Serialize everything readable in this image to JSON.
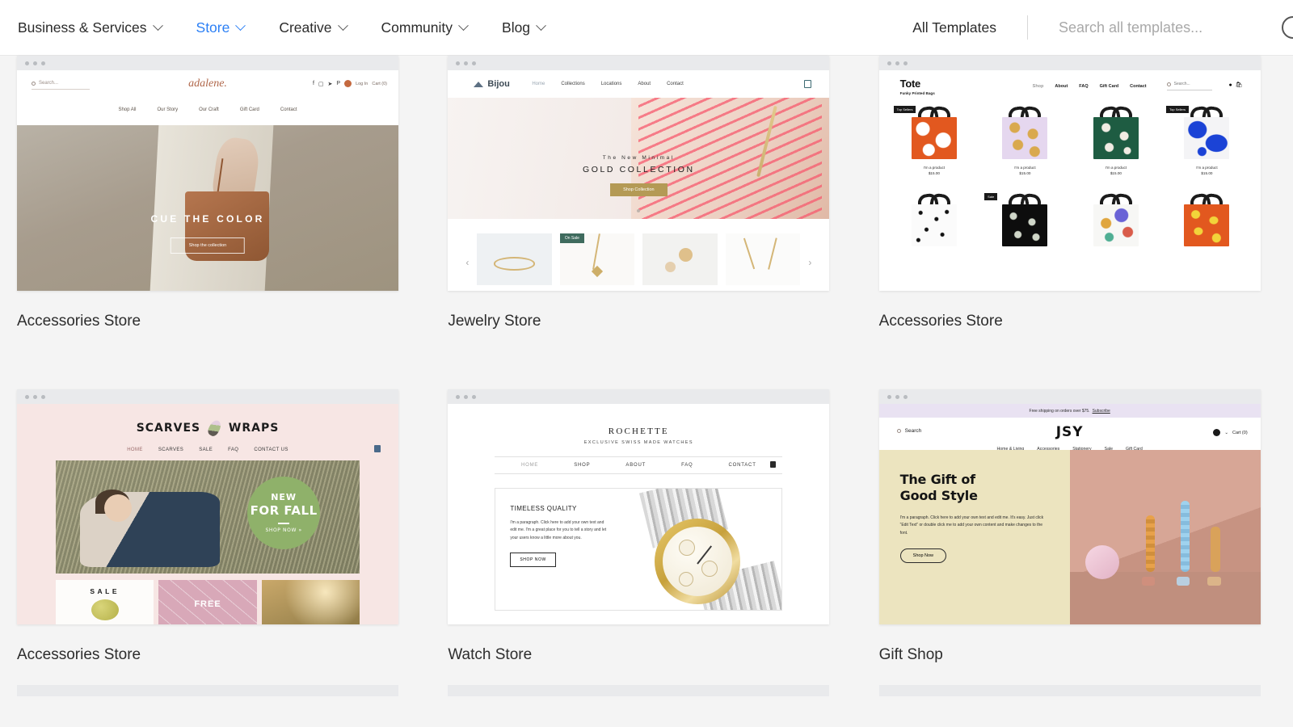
{
  "header": {
    "nav": [
      {
        "label": "Business & Services",
        "active": false
      },
      {
        "label": "Store",
        "active": true
      },
      {
        "label": "Creative",
        "active": false
      },
      {
        "label": "Community",
        "active": false
      },
      {
        "label": "Blog",
        "active": false
      }
    ],
    "all_templates_label": "All Templates",
    "search_placeholder": "Search all templates...",
    "search_value": "",
    "accent_color": "#2b7ff5",
    "icons": {
      "chevron": "chevron-down-icon",
      "search": "search-icon"
    }
  },
  "templates": [
    {
      "caption": "Accessories Store",
      "brand": "adalene.",
      "search_label": "Search...",
      "account_label": "Log In",
      "cart_label": "Cart (0)",
      "nav": [
        "Shop All",
        "Our Story",
        "Our Craft",
        "Gift Card",
        "Contact"
      ],
      "social": [
        "f",
        "□",
        "✈",
        "P"
      ],
      "hero_title": "CUE THE COLOR",
      "hero_button": "Shop the collection"
    },
    {
      "caption": "Jewelry Store",
      "brand": "Bijou",
      "nav": [
        "Home",
        "Collections",
        "Locations",
        "About",
        "Contact"
      ],
      "hero_eyebrow": "The New Minimal",
      "hero_title": "GOLD COLLECTION",
      "hero_button": "Shop Collection",
      "sale_badge": "On Sale",
      "arrow_prev": "‹",
      "arrow_next": "›"
    },
    {
      "caption": "Accessories Store",
      "brand": "Tote",
      "tagline": "Funky Printed Bags",
      "nav": [
        "Shop",
        "About",
        "FAQ",
        "Gift Card",
        "Contact"
      ],
      "search_label": "Search...",
      "badge_top": "Top Sellers",
      "badge_sale": "Sale",
      "product_name": "I'm a product",
      "product_price": "$15.00",
      "products_row1": [
        {
          "name": "I'm a product",
          "price": "$15.00",
          "badge": "Top Sellers"
        },
        {
          "name": "I'm a product",
          "price": "$15.00",
          "badge": ""
        },
        {
          "name": "I'm a product",
          "price": "$15.00",
          "badge": ""
        },
        {
          "name": "I'm a product",
          "price": "$15.00",
          "badge": "Top Sellers"
        }
      ],
      "products_row2": [
        {
          "badge": ""
        },
        {
          "badge": "Sale"
        },
        {
          "badge": ""
        },
        {
          "badge": ""
        }
      ]
    },
    {
      "caption": "Accessories Store",
      "brand_left": "SCARVES",
      "brand_right": "WRAPS",
      "nav": [
        "HOME",
        "SCARVES",
        "SALE",
        "FAQ",
        "CONTACT US"
      ],
      "badge_line1": "NEW",
      "badge_line2": "FOR FALL",
      "badge_cta": "SHOP NOW »",
      "tile1": "SALE",
      "tile2": "FREE"
    },
    {
      "caption": "Watch Store",
      "brand": "ROCHETTE",
      "tagline": "EXCLUSIVE SWISS MADE WATCHES",
      "nav": [
        "HOME",
        "SHOP",
        "ABOUT",
        "FAQ",
        "CONTACT"
      ],
      "hero_title": "TIMELESS QUALITY",
      "hero_paragraph": "I'm a paragraph. Click here to add your own text and edit me. I'm a great place for you to tell a story and let your users know a little more about you.",
      "hero_button": "SHOP NOW"
    },
    {
      "caption": "Gift Shop",
      "announcement": "Free shipping on orders over $75.",
      "announcement_link": "Subscribe",
      "brand": "JSY",
      "search_label": "Search",
      "cart_label": "Cart (0)",
      "nav": [
        "Home & Living",
        "Accessories",
        "Stationery",
        "Sale",
        "Gift Card"
      ],
      "hero_title_1": "The Gift of",
      "hero_title_2": "Good Style",
      "hero_paragraph": "I'm a paragraph. Click here to add your own text and edit me. It's easy. Just click “Edit Text” or double click me to add your own content and make changes to the font.",
      "hero_button": "Shop Now"
    }
  ]
}
